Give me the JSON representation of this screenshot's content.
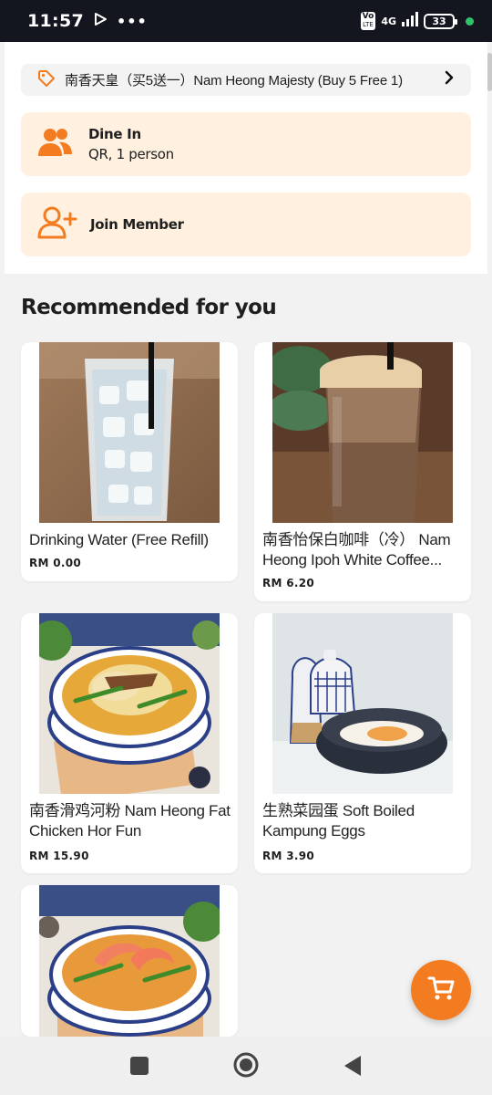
{
  "status_bar": {
    "time": "11:57",
    "network_vo": "Vo",
    "network_lte": "LTE",
    "network_type": "4G",
    "battery": "33"
  },
  "promo": {
    "text": "南香天皇（买5送一）Nam Heong Majesty (Buy 5 Free 1)",
    "icon": "tag-icon"
  },
  "order_mode": {
    "title": "Dine In",
    "subtitle": "QR, 1 person",
    "icon": "people-icon"
  },
  "member": {
    "title": "Join Member",
    "icon": "add-user-icon"
  },
  "section": {
    "title": "Recommended for you"
  },
  "products": [
    {
      "name": "Drinking Water (Free Refill)",
      "price": "RM 0.00"
    },
    {
      "name": "南香怡保白咖啡（冷） Nam Heong Ipoh White Coffee...",
      "price": "RM 6.20"
    },
    {
      "name": "南香滑鸡河粉 Nam Heong Fat Chicken Hor Fun",
      "price": "RM 15.90"
    },
    {
      "name": "生熟菜园蛋 Soft Boiled Kampung Eggs",
      "price": "RM 3.90"
    },
    {
      "name": "",
      "price": ""
    }
  ],
  "colors": {
    "accent": "#f47c20",
    "card_bg": "#fff0df",
    "status_bar": "#14161f"
  }
}
